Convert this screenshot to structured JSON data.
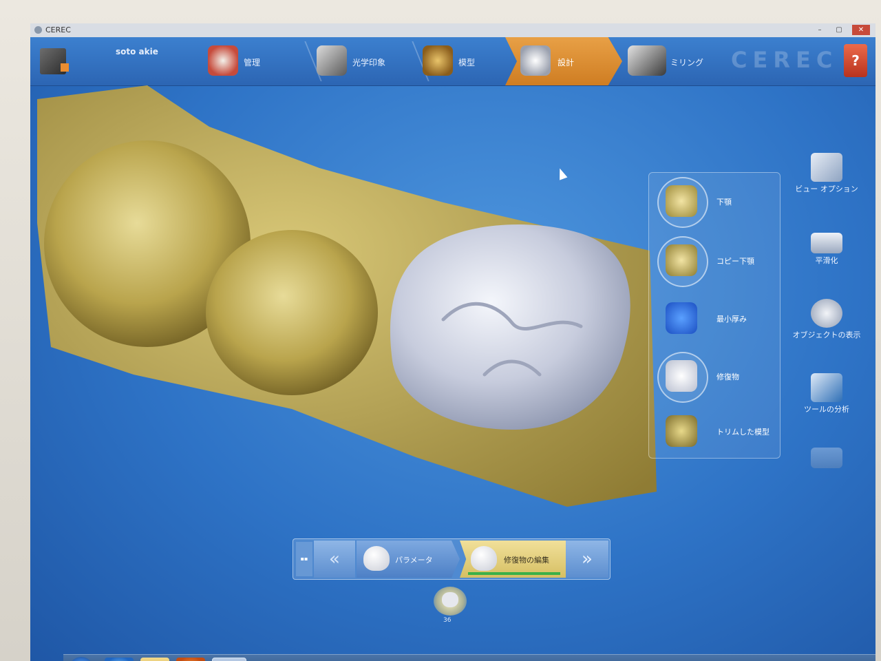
{
  "window": {
    "title": "CEREC",
    "min": "–",
    "max": "▢",
    "close": "✕"
  },
  "patient": {
    "name": "soto akie"
  },
  "steps": [
    {
      "label": "管理"
    },
    {
      "label": "光学印象"
    },
    {
      "label": "模型"
    },
    {
      "label": "設計"
    },
    {
      "label": "ミリング"
    }
  ],
  "brand": {
    "logo": "CEREC",
    "help": "?"
  },
  "panel": {
    "items": [
      {
        "label": "下顎"
      },
      {
        "label": "コピー下顎"
      },
      {
        "label": "最小厚み"
      },
      {
        "label": "修復物"
      },
      {
        "label": "トリムした模型"
      }
    ]
  },
  "right_tools": [
    {
      "label": "ビュー オプション"
    },
    {
      "label": "平滑化"
    },
    {
      "label": "オブジェクトの表示"
    },
    {
      "label": "ツールの分析"
    }
  ],
  "wizard": {
    "prev": "«",
    "next": "»",
    "steps": [
      {
        "label": "パラメータ"
      },
      {
        "label": "修復物の編集"
      }
    ]
  },
  "selected_tooth": {
    "number": "36"
  },
  "colors": {
    "accent": "#cf7d22",
    "background": "#2e73c6",
    "model": "#c9b45a",
    "crown": "#c7ccdd"
  }
}
